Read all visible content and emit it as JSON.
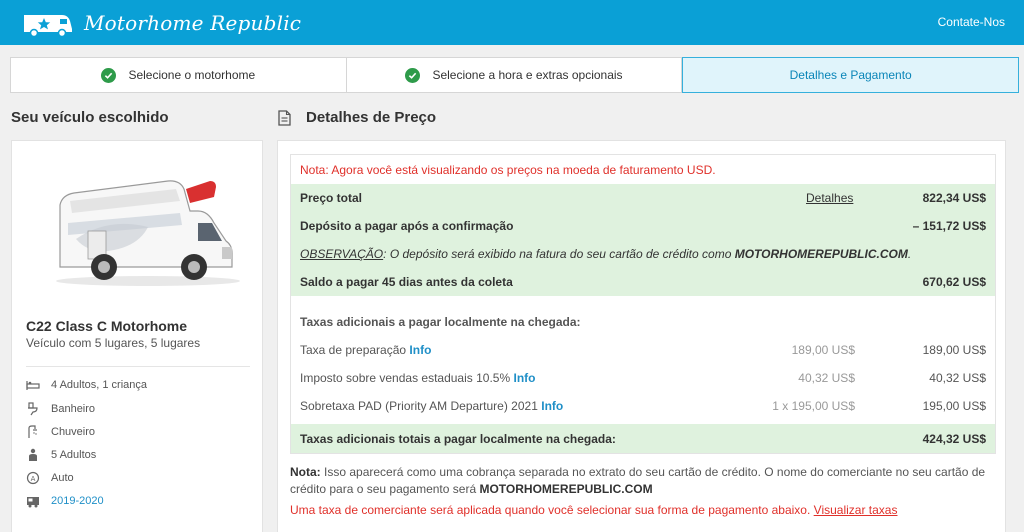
{
  "brand": {
    "name": "Motorhome Republic",
    "color": "#0aa0d6"
  },
  "header": {
    "contact_label": "Contate-Nos"
  },
  "steps": [
    {
      "label": "Selecione o motorhome",
      "state": "done"
    },
    {
      "label": "Selecione a hora e extras opcionais",
      "state": "done"
    },
    {
      "label": "Detalhes e Pagamento",
      "state": "active"
    }
  ],
  "vehicle": {
    "section_title": "Seu veículo escolhido",
    "name": "C22 Class C Motorhome",
    "subtitle": "Veículo com 5 lugares, 5 lugares",
    "features": [
      {
        "icon": "bed-icon",
        "label": "4 Adultos, 1 criança"
      },
      {
        "icon": "toilet-icon",
        "label": "Banheiro"
      },
      {
        "icon": "shower-icon",
        "label": "Chuveiro"
      },
      {
        "icon": "person-icon",
        "label": "5 Adultos"
      },
      {
        "icon": "automatic-transmission-icon",
        "label": "Auto"
      },
      {
        "icon": "vehicle-year-icon",
        "label": "2019-2020"
      }
    ]
  },
  "pricing": {
    "section_title": "Detalhes de Preço",
    "currency_note": "Nota: Agora você está visualizando os preços na moeda de faturamento USD.",
    "total_label": "Preço total",
    "details_link": "Detalhes",
    "total_amount": "822,34 US$",
    "deposit_label": "Depósito a pagar após a confirmação",
    "deposit_amount": "– 151,72 US$",
    "observation_prefix": "OBSERVAÇÃO",
    "observation_text": ": O depósito será exibido na fatura do seu cartão de crédito como ",
    "observation_merchant": "MOTORHOMEREPUBLIC.COM",
    "observation_suffix": ".",
    "balance_label": "Saldo a pagar 45 dias antes da coleta",
    "balance_amount": "670,62 US$",
    "local_fees_heading": "Taxas adicionais a pagar localmente na chegada:",
    "local_fees": [
      {
        "label": "Taxa de preparação",
        "info": "Info",
        "unit": "189,00 US$",
        "amount": "189,00 US$"
      },
      {
        "label": "Imposto sobre vendas estaduais 10.5%",
        "info": "Info",
        "unit": "40,32 US$",
        "amount": "40,32 US$"
      },
      {
        "label": "Sobretaxa PAD (Priority AM Departure) 2021",
        "info": "Info",
        "unit": "1 x 195,00 US$",
        "amount": "195,00 US$"
      }
    ],
    "local_total_label": "Taxas adicionais totais a pagar localmente na chegada:",
    "local_total_amount": "424,32 US$",
    "note_label": "Nota:",
    "note_text": " Isso aparecerá como uma cobrança separada no extrato do seu cartão de crédito. O nome do comerciante no seu cartão de crédito para o seu pagamento será ",
    "note_merchant": "MOTORHOMEREPUBLIC.COM",
    "merchant_fee_text": "Uma taxa de comerciante será aplicada quando você selecionar sua forma de pagamento abaixo. ",
    "merchant_fee_link": "Visualizar taxas"
  }
}
